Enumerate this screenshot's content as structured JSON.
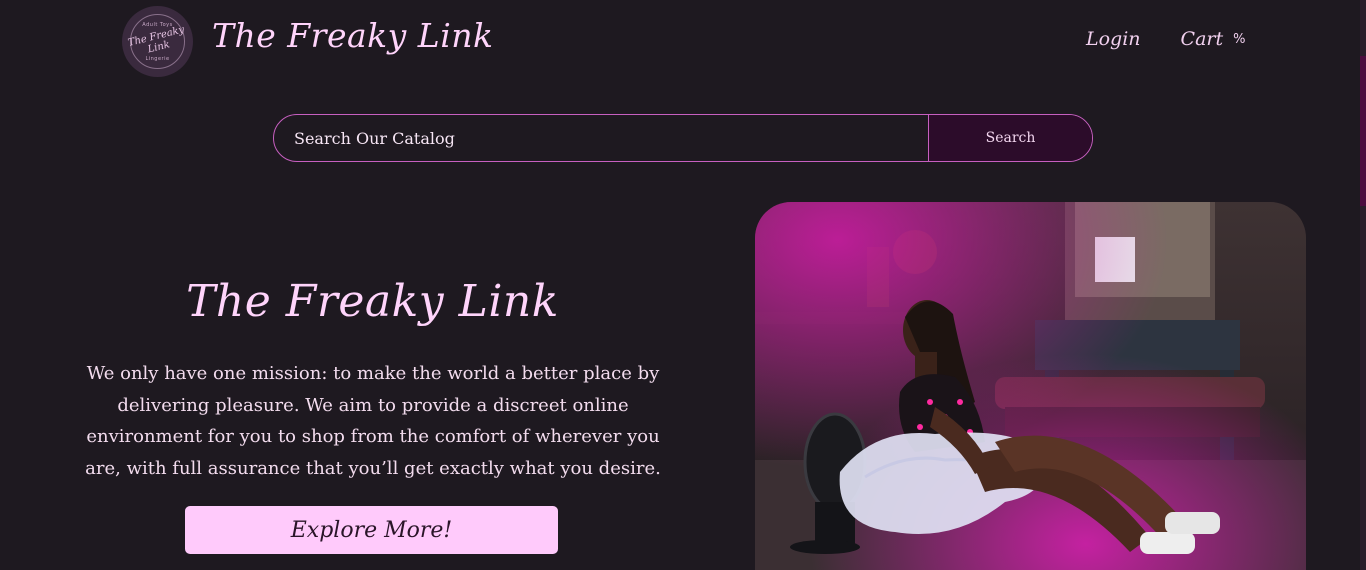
{
  "header": {
    "logo": {
      "top_text": "Adult Toys",
      "main_text": "The Freaky Link",
      "bottom_text": "Lingerie"
    },
    "brand": "The Freaky Link",
    "nav": {
      "login": "Login",
      "cart": "Cart",
      "cart_icon": "%"
    }
  },
  "search": {
    "placeholder": "Search Our Catalog",
    "button": "Search"
  },
  "hero": {
    "title": "The Freaky Link",
    "text": "We only have one mission: to make the world a better place by delivering pleasure. We aim to provide a discreet online environment for you to shop from the comfort of wherever you are, with full assurance that you’ll get exactly what you desire.",
    "button": "Explore More!",
    "image_alt": "model-photo"
  },
  "colors": {
    "background": "#1e1920",
    "accent": "#c75fc0",
    "title_pink": "#ffd4fb",
    "button_pink": "#ffcafb",
    "search_button": "#2c0c2a"
  }
}
